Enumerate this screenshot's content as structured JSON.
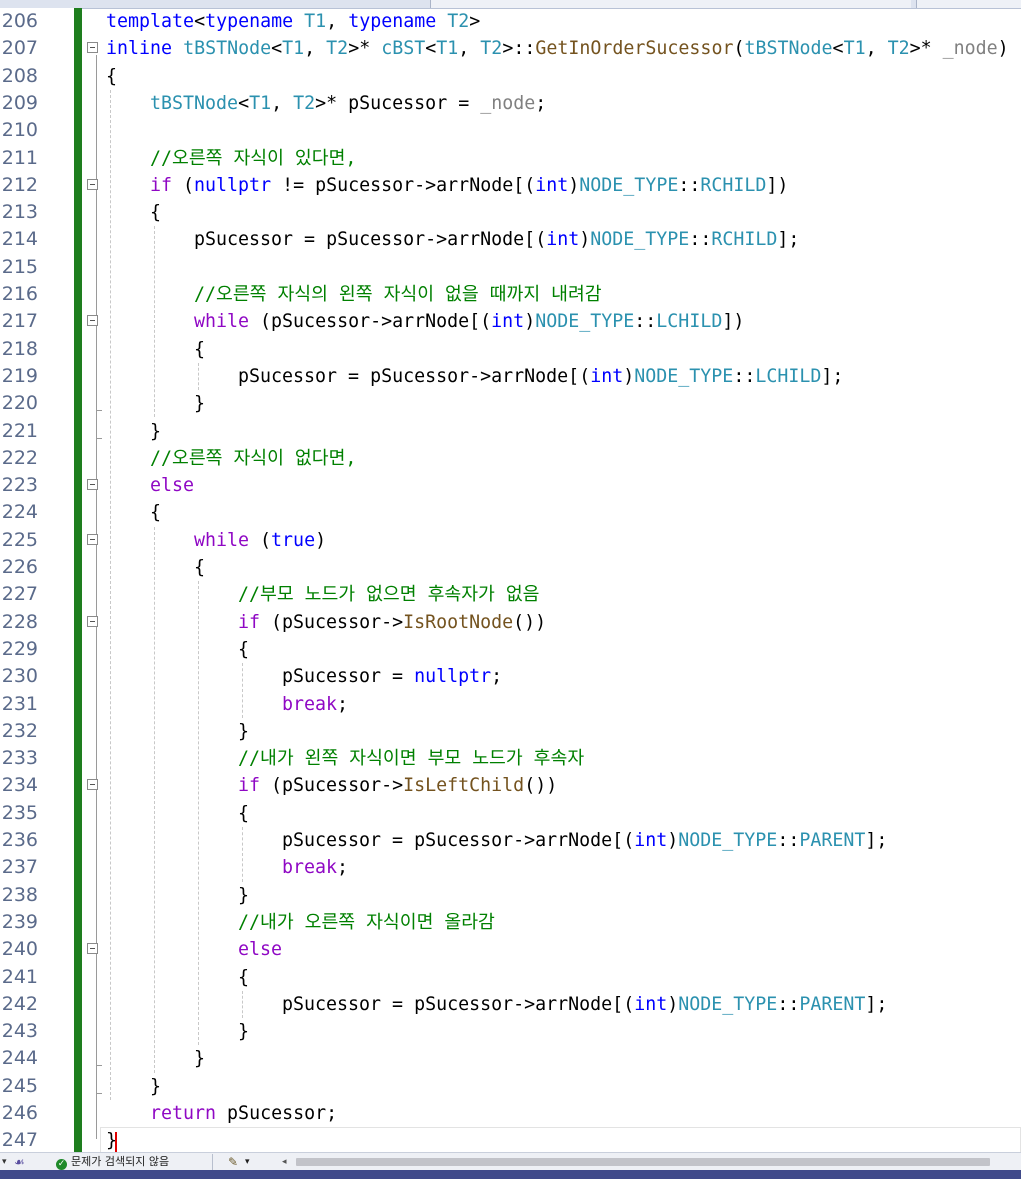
{
  "status_bar": {
    "no_issues_label": "문제가 검색되지 않음",
    "status_icon": "check-circle-icon",
    "brush_icon": "code-cleanup-icon",
    "dropdown_icon": "chevron-down-icon",
    "scroll_left_icon": "arrow-left-icon"
  },
  "colors": {
    "keyword": "#0000ff",
    "control": "#8f08c4",
    "type": "#2b91af",
    "comment": "#008000",
    "parameter": "#808080",
    "change_bar": "#1e7e1e",
    "caret": "#e00000"
  },
  "lines": [
    {
      "n": "206",
      "indent": 0,
      "fold": false,
      "tokens": [
        [
          "kw",
          "template"
        ],
        [
          "",
          "<"
        ],
        [
          "kw",
          "typename"
        ],
        [
          "",
          " "
        ],
        [
          "typ",
          "T1"
        ],
        [
          "",
          ", "
        ],
        [
          "kw",
          "typename"
        ],
        [
          "",
          " "
        ],
        [
          "typ",
          "T2"
        ],
        [
          "",
          ">"
        ]
      ]
    },
    {
      "n": "207",
      "indent": 0,
      "fold": true,
      "tokens": [
        [
          "kw",
          "inline"
        ],
        [
          "",
          " "
        ],
        [
          "typ",
          "tBSTNode"
        ],
        [
          "",
          "<"
        ],
        [
          "typ",
          "T1"
        ],
        [
          "",
          ", "
        ],
        [
          "typ",
          "T2"
        ],
        [
          "",
          ">* "
        ],
        [
          "typ",
          "cBST"
        ],
        [
          "",
          "<"
        ],
        [
          "typ",
          "T1"
        ],
        [
          "",
          ", "
        ],
        [
          "typ",
          "T2"
        ],
        [
          "",
          ">::"
        ],
        [
          "fn",
          "GetInOrderSucessor"
        ],
        [
          "",
          "("
        ],
        [
          "typ",
          "tBSTNode"
        ],
        [
          "",
          "<"
        ],
        [
          "typ",
          "T1"
        ],
        [
          "",
          ", "
        ],
        [
          "typ",
          "T2"
        ],
        [
          "",
          ">* "
        ],
        [
          "pm",
          "_node"
        ],
        [
          "",
          ")"
        ]
      ]
    },
    {
      "n": "208",
      "indent": 0,
      "fold": false,
      "tokens": [
        [
          "",
          "{"
        ]
      ]
    },
    {
      "n": "209",
      "indent": 1,
      "fold": false,
      "tokens": [
        [
          "typ",
          "tBSTNode"
        ],
        [
          "",
          "<"
        ],
        [
          "typ",
          "T1"
        ],
        [
          "",
          ", "
        ],
        [
          "typ",
          "T2"
        ],
        [
          "",
          ">* pSucessor = "
        ],
        [
          "pm",
          "_node"
        ],
        [
          "",
          ";"
        ]
      ]
    },
    {
      "n": "210",
      "indent": 1,
      "fold": false,
      "tokens": []
    },
    {
      "n": "211",
      "indent": 1,
      "fold": false,
      "tokens": [
        [
          "cm",
          "//오른쪽 자식이 있다면,"
        ]
      ]
    },
    {
      "n": "212",
      "indent": 1,
      "fold": true,
      "tokens": [
        [
          "ctl",
          "if"
        ],
        [
          "",
          " ("
        ],
        [
          "kw",
          "nullptr"
        ],
        [
          "",
          " != pSucessor->arrNode[("
        ],
        [
          "kw",
          "int"
        ],
        [
          "",
          ")"
        ],
        [
          "typ",
          "NODE_TYPE"
        ],
        [
          "",
          "::"
        ],
        [
          "typ",
          "RCHILD"
        ],
        [
          "",
          "])"
        ]
      ]
    },
    {
      "n": "213",
      "indent": 1,
      "fold": false,
      "tokens": [
        [
          "",
          "{"
        ]
      ]
    },
    {
      "n": "214",
      "indent": 2,
      "fold": false,
      "tokens": [
        [
          "",
          "pSucessor = pSucessor->arrNode[("
        ],
        [
          "kw",
          "int"
        ],
        [
          "",
          ")"
        ],
        [
          "typ",
          "NODE_TYPE"
        ],
        [
          "",
          "::"
        ],
        [
          "typ",
          "RCHILD"
        ],
        [
          "",
          "];"
        ]
      ]
    },
    {
      "n": "215",
      "indent": 2,
      "fold": false,
      "tokens": []
    },
    {
      "n": "216",
      "indent": 2,
      "fold": false,
      "tokens": [
        [
          "cm",
          "//오른쪽 자식의 왼쪽 자식이 없을 때까지 내려감"
        ]
      ]
    },
    {
      "n": "217",
      "indent": 2,
      "fold": true,
      "tokens": [
        [
          "ctl",
          "while"
        ],
        [
          "",
          " (pSucessor->arrNode[("
        ],
        [
          "kw",
          "int"
        ],
        [
          "",
          ")"
        ],
        [
          "typ",
          "NODE_TYPE"
        ],
        [
          "",
          "::"
        ],
        [
          "typ",
          "LCHILD"
        ],
        [
          "",
          "])"
        ]
      ]
    },
    {
      "n": "218",
      "indent": 2,
      "fold": false,
      "tokens": [
        [
          "",
          "{"
        ]
      ]
    },
    {
      "n": "219",
      "indent": 3,
      "fold": false,
      "tokens": [
        [
          "",
          "pSucessor = pSucessor->arrNode[("
        ],
        [
          "kw",
          "int"
        ],
        [
          "",
          ")"
        ],
        [
          "typ",
          "NODE_TYPE"
        ],
        [
          "",
          "::"
        ],
        [
          "typ",
          "LCHILD"
        ],
        [
          "",
          "];"
        ]
      ]
    },
    {
      "n": "220",
      "indent": 2,
      "fold": false,
      "tokens": [
        [
          "",
          "}"
        ]
      ]
    },
    {
      "n": "221",
      "indent": 1,
      "fold": false,
      "tokens": [
        [
          "",
          "}"
        ]
      ]
    },
    {
      "n": "222",
      "indent": 1,
      "fold": false,
      "tokens": [
        [
          "cm",
          "//오른쪽 자식이 없다면,"
        ]
      ]
    },
    {
      "n": "223",
      "indent": 1,
      "fold": true,
      "tokens": [
        [
          "ctl",
          "else"
        ]
      ]
    },
    {
      "n": "224",
      "indent": 1,
      "fold": false,
      "tokens": [
        [
          "",
          "{"
        ]
      ]
    },
    {
      "n": "225",
      "indent": 2,
      "fold": true,
      "tokens": [
        [
          "ctl",
          "while"
        ],
        [
          "",
          " ("
        ],
        [
          "kw",
          "true"
        ],
        [
          "",
          ")"
        ]
      ]
    },
    {
      "n": "226",
      "indent": 2,
      "fold": false,
      "tokens": [
        [
          "",
          "{"
        ]
      ]
    },
    {
      "n": "227",
      "indent": 3,
      "fold": false,
      "tokens": [
        [
          "cm",
          "//부모 노드가 없으면 후속자가 없음"
        ]
      ]
    },
    {
      "n": "228",
      "indent": 3,
      "fold": true,
      "tokens": [
        [
          "ctl",
          "if"
        ],
        [
          "",
          " (pSucessor->"
        ],
        [
          "fn",
          "IsRootNode"
        ],
        [
          "",
          "())"
        ]
      ]
    },
    {
      "n": "229",
      "indent": 3,
      "fold": false,
      "tokens": [
        [
          "",
          "{"
        ]
      ]
    },
    {
      "n": "230",
      "indent": 4,
      "fold": false,
      "tokens": [
        [
          "",
          "pSucessor = "
        ],
        [
          "kw",
          "nullptr"
        ],
        [
          "",
          ";"
        ]
      ]
    },
    {
      "n": "231",
      "indent": 4,
      "fold": false,
      "tokens": [
        [
          "ctl",
          "break"
        ],
        [
          "",
          ";"
        ]
      ]
    },
    {
      "n": "232",
      "indent": 3,
      "fold": false,
      "tokens": [
        [
          "",
          "}"
        ]
      ]
    },
    {
      "n": "233",
      "indent": 3,
      "fold": false,
      "tokens": [
        [
          "cm",
          "//내가 왼쪽 자식이면 부모 노드가 후속자"
        ]
      ]
    },
    {
      "n": "234",
      "indent": 3,
      "fold": true,
      "tokens": [
        [
          "ctl",
          "if"
        ],
        [
          "",
          " (pSucessor->"
        ],
        [
          "fn",
          "IsLeftChild"
        ],
        [
          "",
          "())"
        ]
      ]
    },
    {
      "n": "235",
      "indent": 3,
      "fold": false,
      "tokens": [
        [
          "",
          "{"
        ]
      ]
    },
    {
      "n": "236",
      "indent": 4,
      "fold": false,
      "tokens": [
        [
          "",
          "pSucessor = pSucessor->arrNode[("
        ],
        [
          "kw",
          "int"
        ],
        [
          "",
          ")"
        ],
        [
          "typ",
          "NODE_TYPE"
        ],
        [
          "",
          "::"
        ],
        [
          "typ",
          "PARENT"
        ],
        [
          "",
          "];"
        ]
      ]
    },
    {
      "n": "237",
      "indent": 4,
      "fold": false,
      "tokens": [
        [
          "ctl",
          "break"
        ],
        [
          "",
          ";"
        ]
      ]
    },
    {
      "n": "238",
      "indent": 3,
      "fold": false,
      "tokens": [
        [
          "",
          "}"
        ]
      ]
    },
    {
      "n": "239",
      "indent": 3,
      "fold": false,
      "tokens": [
        [
          "cm",
          "//내가 오른쪽 자식이면 올라감"
        ]
      ]
    },
    {
      "n": "240",
      "indent": 3,
      "fold": true,
      "tokens": [
        [
          "ctl",
          "else"
        ]
      ]
    },
    {
      "n": "241",
      "indent": 3,
      "fold": false,
      "tokens": [
        [
          "",
          "{"
        ]
      ]
    },
    {
      "n": "242",
      "indent": 4,
      "fold": false,
      "tokens": [
        [
          "",
          "pSucessor = pSucessor->arrNode[("
        ],
        [
          "kw",
          "int"
        ],
        [
          "",
          ")"
        ],
        [
          "typ",
          "NODE_TYPE"
        ],
        [
          "",
          "::"
        ],
        [
          "typ",
          "PARENT"
        ],
        [
          "",
          "];"
        ]
      ]
    },
    {
      "n": "243",
      "indent": 3,
      "fold": false,
      "tokens": [
        [
          "",
          "}"
        ]
      ]
    },
    {
      "n": "244",
      "indent": 2,
      "fold": false,
      "tokens": [
        [
          "",
          "}"
        ]
      ]
    },
    {
      "n": "245",
      "indent": 1,
      "fold": false,
      "tokens": [
        [
          "",
          "}"
        ]
      ]
    },
    {
      "n": "246",
      "indent": 1,
      "fold": false,
      "tokens": [
        [
          "ctl",
          "return"
        ],
        [
          "",
          " pSucessor;"
        ]
      ]
    },
    {
      "n": "247",
      "indent": 0,
      "fold": false,
      "tokens": [
        [
          "",
          "}"
        ]
      ]
    }
  ]
}
